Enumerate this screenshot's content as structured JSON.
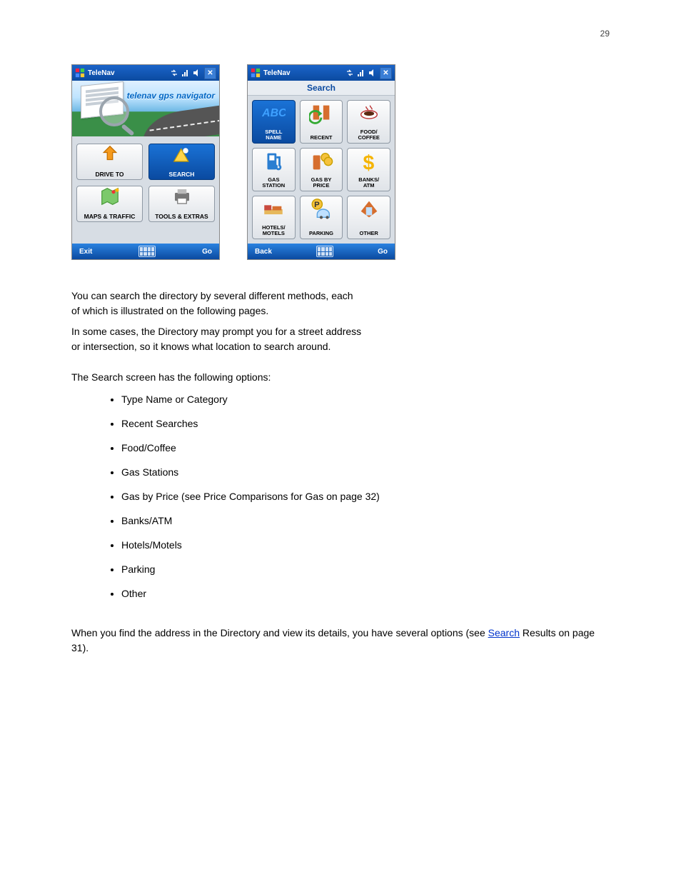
{
  "page_number": "29",
  "titlebar": {
    "app_title": "TeleNav",
    "close_glyph": "✕"
  },
  "screen_home": {
    "banner_text": "telenav gps navigator",
    "tiles": [
      {
        "name": "drive-to",
        "label": "DRIVE TO",
        "selected": false
      },
      {
        "name": "search",
        "label": "SEARCH",
        "selected": true
      },
      {
        "name": "maps-traffic",
        "label": "MAPS & TRAFFIC",
        "selected": false
      },
      {
        "name": "tools-extras",
        "label": "TOOLS & EXTRAS",
        "selected": false
      }
    ],
    "bottom": {
      "left": "Exit",
      "right": "Go"
    }
  },
  "screen_search": {
    "header": "Search",
    "tiles": [
      {
        "name": "spell-name",
        "label": "SPELL\nNAME",
        "selected": true
      },
      {
        "name": "recent",
        "label": "RECENT",
        "selected": false
      },
      {
        "name": "food-coffee",
        "label": "FOOD/\nCOFFEE",
        "selected": false
      },
      {
        "name": "gas-station",
        "label": "GAS\nSTATION",
        "selected": false
      },
      {
        "name": "gas-by-price",
        "label": "GAS BY\nPRICE",
        "selected": false
      },
      {
        "name": "banks-atm",
        "label": "BANKS/\nATM",
        "selected": false
      },
      {
        "name": "hotels-motels",
        "label": "HOTELS/\nMOTELS",
        "selected": false
      },
      {
        "name": "parking",
        "label": "PARKING",
        "selected": false
      },
      {
        "name": "other",
        "label": "OTHER",
        "selected": false
      }
    ],
    "bottom": {
      "left": "Back",
      "right": "Go"
    }
  },
  "intro_1": "You can search the directory by several different methods, each",
  "intro_2": "of which is illustrated on the following pages.",
  "note_1": "In some cases, the Directory may prompt you for a street address",
  "note_2": "or intersection, so it knows what location to search around.",
  "options_intro": "The Search screen has the following options:",
  "options": [
    "Type Name or Category",
    "Recent Searches",
    "Food/Coffee",
    "Gas Stations",
    "Gas by Price (see Price Comparisons for Gas on page 32)",
    "Banks/ATM",
    "Hotels/Motels",
    "Parking",
    "Other"
  ],
  "after_text_pre": "When you find the address in the Directory and view its details, you have several options (see ",
  "after_link_text": "Search",
  "after_link_suffix_1": " Results on page ",
  "after_page_ref": "31",
  "after_link_suffix_2": ")."
}
